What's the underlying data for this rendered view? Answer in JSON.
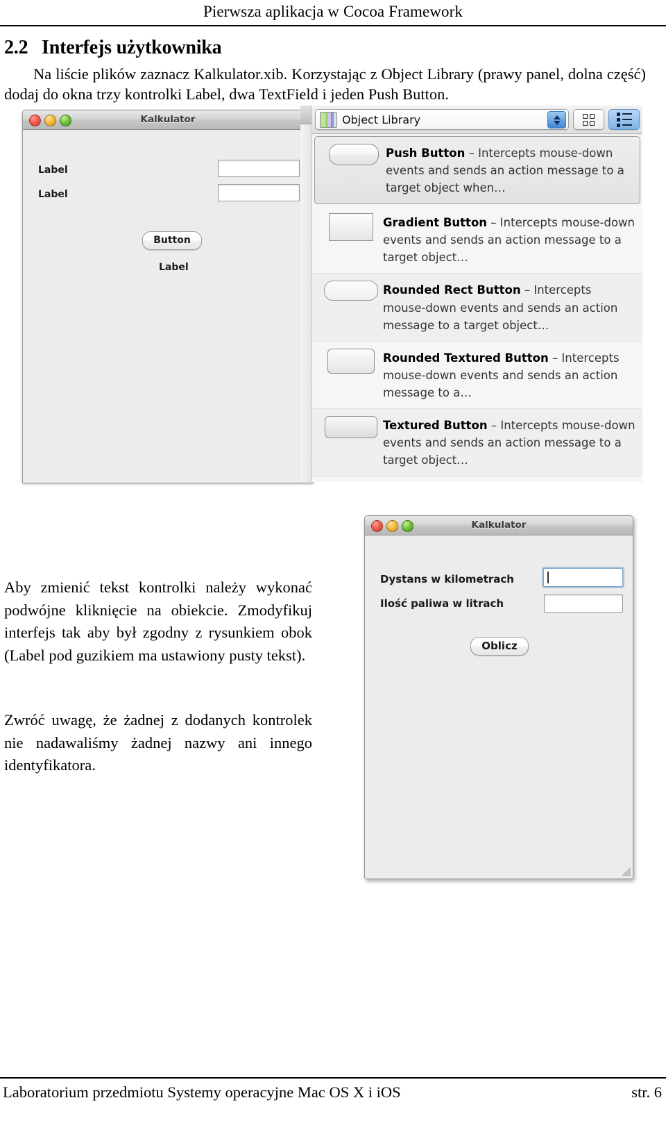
{
  "running_head": "Pierwsza aplikacja w Cocoa Framework",
  "section": {
    "number": "2.2",
    "title": "Interfejs użytkownika",
    "intro": "Na liście plików zaznacz Kalkulator.xib. Korzystając z Object Library (prawy panel, dolna część) dodaj do okna trzy kontrolki Label, dwa TextField i jeden Push Button."
  },
  "figure1": {
    "window": {
      "title": "Kalkulator",
      "traffic_lights": [
        "close-red",
        "minimize-yellow",
        "zoom-green"
      ],
      "labels": [
        "Label",
        "Label",
        "Label"
      ],
      "button": "Button",
      "fields": [
        "",
        ""
      ]
    },
    "library": {
      "popup_label": "Object Library",
      "popup_icon": "library-stack-icon",
      "stepper_icon": "stepper-updown-icon",
      "view_grid_icon": "grid-view-icon",
      "view_list_icon": "list-view-icon",
      "items": [
        {
          "name": "Push Button",
          "desc": "– Intercepts mouse-down events and sends an action message to a target object when…",
          "thumb": "push-button-thumb",
          "selected": true
        },
        {
          "name": "Gradient Button",
          "desc": "– Intercepts mouse-down events and sends an action message to a target object…",
          "thumb": "gradient-button-thumb",
          "selected": false
        },
        {
          "name": "Rounded Rect Button",
          "desc": "– Intercepts mouse-down events and sends an action message to a target object…",
          "thumb": "rounded-rect-button-thumb",
          "selected": false
        },
        {
          "name": "Rounded Textured Button",
          "desc": "– Intercepts mouse-down events and sends an action message to a…",
          "thumb": "rounded-textured-button-thumb",
          "selected": false
        },
        {
          "name": "Textured Button",
          "desc": "– Intercepts mouse-down events and sends an action message to a target object…",
          "thumb": "textured-button-thumb",
          "selected": false
        }
      ]
    }
  },
  "body": {
    "p1": "Aby zmienić tekst kontrolki należy wykonać podwójne kliknięcie na obiekcie. Zmodyfikuj interfejs tak aby był zgodny z rysunkiem obok (Label pod guzikiem ma ustawiony pusty tekst).",
    "p2": "Zwróć uwagę, że żadnej z dodanych kontrolek nie nadawaliśmy żadnej nazwy ani innego identyfikatora."
  },
  "figure2": {
    "window": {
      "title": "Kalkulator",
      "traffic_lights": [
        "close-red",
        "minimize-yellow",
        "zoom-green"
      ],
      "label_distance": "Dystans w kilometrach",
      "label_fuel": "Ilość paliwa w litrach",
      "button": "Oblicz",
      "field_distance_value": "",
      "field_fuel_value": "",
      "result_label": ""
    }
  },
  "footer": {
    "left": "Laboratorium przedmiotu Systemy operacyjne Mac OS X i iOS",
    "right": "str. 6"
  }
}
